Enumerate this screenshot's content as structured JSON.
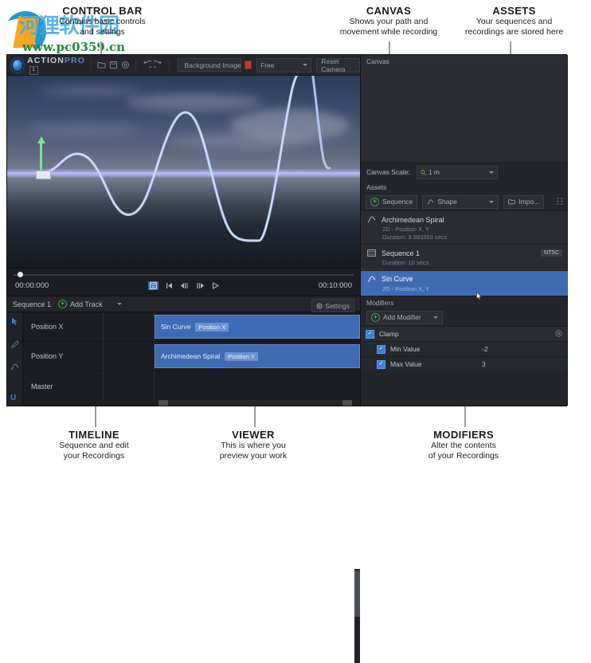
{
  "watermark": {
    "cn": "河狸软件园",
    "url": "www.pc0359.cn"
  },
  "annotations": [
    {
      "title": "CONTROL BAR",
      "desc_line1": "Contains basic controls",
      "desc_line2": "and settings"
    },
    {
      "title": "CANVAS",
      "desc_line1": "Shows your path and",
      "desc_line2": "movement while recording"
    },
    {
      "title": "ASSETS",
      "desc_line1": "Your sequences and",
      "desc_line2": "recordings are stored here"
    },
    {
      "title": "TIMELINE",
      "desc_line1": "Sequence and edit",
      "desc_line2": "your Recordings"
    },
    {
      "title": "VIEWER",
      "desc_line1": "This is where you",
      "desc_line2": "preview your work"
    },
    {
      "title": "MODIFIERS",
      "desc_line1": "Alter the contents",
      "desc_line2": "of your Recordings"
    }
  ],
  "control_bar": {
    "logo_action": "ACTION",
    "logo_pro": "PRO",
    "logo_badge": "1",
    "icons": [
      "folder-icon",
      "save-icon",
      "settings-icon",
      "undo-icon",
      "redo-icon"
    ],
    "background_field": "Background Image...",
    "color_swatch": "#c0392b",
    "camera_mode": "Free",
    "reset_camera": "Reset Camera"
  },
  "transport": {
    "time_start": "00:00:000",
    "time_end": "00:10:000",
    "buttons": [
      "loop-icon",
      "skip-start-icon",
      "step-back-icon",
      "step-forward-icon",
      "play-icon"
    ]
  },
  "timeline": {
    "sequence_label": "Sequence 1",
    "add_track": "Add Track",
    "settings": "Settings",
    "tools": [
      "select-tool-icon",
      "pencil-tool-icon",
      "curve-tool-icon"
    ],
    "u_badge": "U",
    "tracks": [
      {
        "name": "Position X",
        "clip_name": "Sin Curve",
        "clip_tag": "Position X",
        "has_clip": true
      },
      {
        "name": "Position Y",
        "clip_name": "Archimedean Spiral",
        "clip_tag": "Position Y",
        "has_clip": true
      },
      {
        "name": "Master",
        "clip_name": "",
        "clip_tag": "",
        "has_clip": false
      }
    ]
  },
  "right_panel": {
    "canvas_header": "Canvas",
    "canvas_scale_label": "Canvas Scale:",
    "canvas_scale_value": "1 m",
    "assets_header": "Assets",
    "btn_sequence": "Sequence",
    "btn_shape": "Shape",
    "btn_import": "Impo...",
    "assets": [
      {
        "name": "Archimedean Spiral",
        "sub1": "2D - Position X, Y",
        "sub2": "Duration: 9.983353 secs",
        "badge": "",
        "selected": false,
        "icon": "curve-icon"
      },
      {
        "name": "Sequence 1",
        "sub1": "Duration: 10 secs",
        "sub2": "",
        "badge": "NTSC",
        "selected": false,
        "icon": "sequence-icon"
      },
      {
        "name": "Sin Curve",
        "sub1": "2D - Position X, Y",
        "sub2": "",
        "badge": "",
        "selected": true,
        "icon": "curve-icon"
      }
    ],
    "modifiers_header": "Modifiers",
    "add_modifier": "Add Modifier",
    "modifier_name": "Clamp",
    "modifier_rows": [
      {
        "label": "Min Value",
        "value": "-2"
      },
      {
        "label": "Max Value",
        "value": "3"
      }
    ]
  }
}
